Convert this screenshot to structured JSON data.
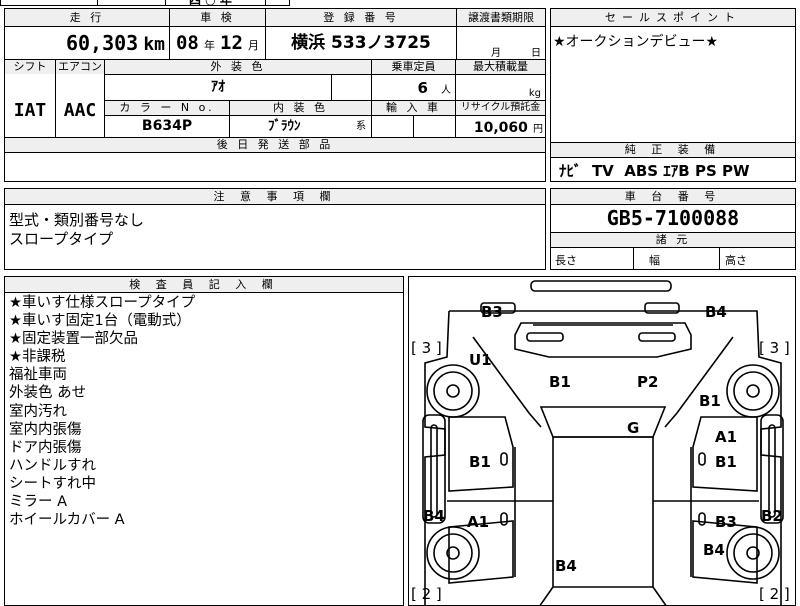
{
  "top_cut": {
    "left": "",
    "middle": "四 ○ 年"
  },
  "spec": {
    "mileage_label": "走 行",
    "mileage": "60,303",
    "mileage_unit": "km",
    "inspection_label": "車 検",
    "inspection_year": "08",
    "year_unit": "年",
    "inspection_month": "12",
    "month_unit": "月",
    "reg_label": "登 録 番 号",
    "reg_number": "横浜 533ノ3725",
    "transfer_label": "譲渡書類期限",
    "transfer_month_unit": "月",
    "transfer_day_unit": "日",
    "shift_label": "シフト",
    "shift": "IAT",
    "ac_label": "エアコン",
    "ac": "AAC",
    "exterior_label": "外 装 色",
    "exterior": "ｱｵ",
    "capacity_label": "乗車定員",
    "capacity": "6",
    "capacity_unit": "人",
    "load_label": "最大積載量",
    "load_unit": "kg",
    "color_no_label": "カ ラ ー N o.",
    "color_no": "B634P",
    "interior_label": "内 装 色",
    "interior": "ﾌﾞﾗｳﾝ",
    "interior_suffix": "系",
    "import_label": "輸 入 車",
    "recycle_label": "リサイクル預託金",
    "recycle": "10,060",
    "recycle_unit": "円",
    "later_parts_label": "後 日 発 送 部 品"
  },
  "sales_point": {
    "label": "セールスポイント",
    "text": "★オークションデビュー★"
  },
  "equipment": {
    "label": "純 正 装 備",
    "items": "ﾅﾋﾞ  TV  ABS ｴｱB PS PW"
  },
  "caution": {
    "label": "注 意 事 項 欄",
    "lines": [
      "型式・類別番号なし",
      "スロープタイプ"
    ]
  },
  "chassis": {
    "label": "車 台 番 号",
    "number": "GB5-7100088"
  },
  "dimensions": {
    "label": "諸 元",
    "length": "長さ",
    "width": "幅",
    "height": "高さ"
  },
  "inspector": {
    "label": "検 査 員 記 入 欄",
    "lines": [
      "★車いす仕様スロープタイプ",
      "★車いす固定1台（電動式）",
      "★固定装置一部欠品",
      "★非課税",
      "福祉車両",
      "外装色 あせ",
      "室内汚れ",
      "室内内張傷",
      "ドア内張傷",
      "ハンドルすれ",
      "シートすれ中",
      "ミラー A",
      "ホイールカバー A"
    ]
  },
  "diagram": {
    "tire_left_top": "[ 3 ]",
    "tire_right_top": "[ 3 ]",
    "tire_left_bottom": "[ 2 ]",
    "tire_right_bottom": "[ 2 ]",
    "marks": [
      {
        "id": "b3-top",
        "text": "B3"
      },
      {
        "id": "b4-top",
        "text": "B4"
      },
      {
        "id": "u1",
        "text": "U1"
      },
      {
        "id": "b1-hood",
        "text": "B1"
      },
      {
        "id": "p2",
        "text": "P2"
      },
      {
        "id": "b1-right-fender",
        "text": "B1"
      },
      {
        "id": "g",
        "text": "G"
      },
      {
        "id": "a1-right",
        "text": "A1"
      },
      {
        "id": "b1-left-door",
        "text": "B1"
      },
      {
        "id": "b1-right-door",
        "text": "B1"
      },
      {
        "id": "b4-left",
        "text": "B4"
      },
      {
        "id": "a1-left",
        "text": "A1"
      },
      {
        "id": "b3-right",
        "text": "B3"
      },
      {
        "id": "b2",
        "text": "B2"
      },
      {
        "id": "b4-right-rear",
        "text": "B4"
      },
      {
        "id": "b4-rear",
        "text": "B4"
      }
    ]
  }
}
